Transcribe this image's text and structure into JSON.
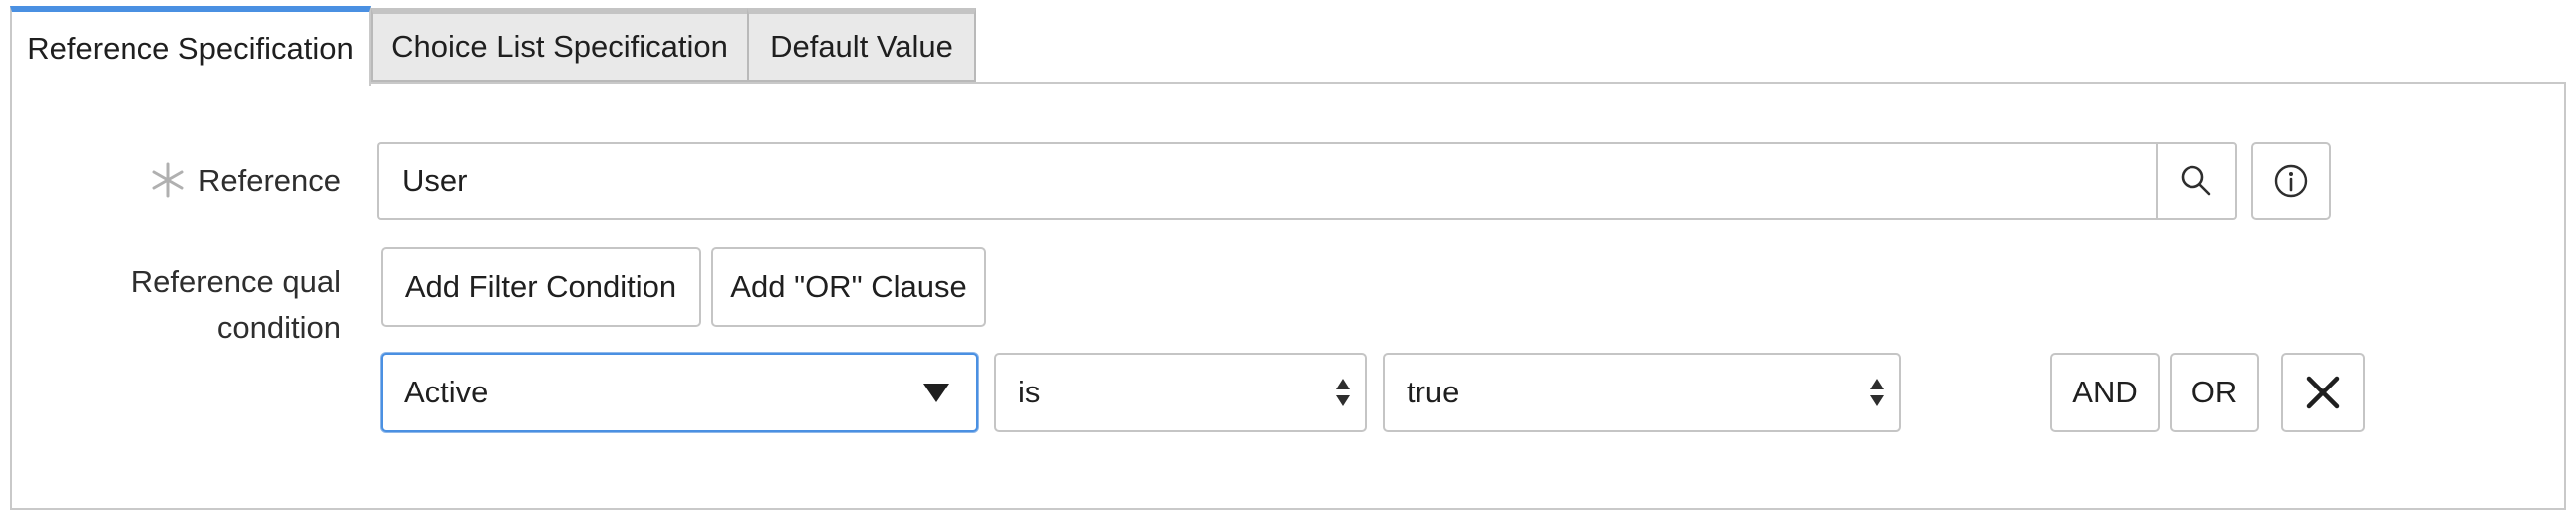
{
  "tabs": [
    {
      "label": "Reference Specification",
      "active": true
    },
    {
      "label": "Choice List Specification",
      "active": false
    },
    {
      "label": "Default Value",
      "active": false
    }
  ],
  "reference": {
    "label": "Reference",
    "required": true,
    "value": "User",
    "search_icon": "search-icon",
    "info_icon": "info-icon"
  },
  "qual_condition": {
    "label_line1": "Reference qual",
    "label_line2": "condition",
    "add_filter_label": "Add Filter Condition",
    "add_or_label": "Add \"OR\" Clause",
    "field_value": "Active",
    "operator_value": "is",
    "value_value": "true",
    "and_label": "AND",
    "or_label": "OR",
    "remove_icon": "close-icon"
  },
  "colors": {
    "accent": "#4a90e2",
    "required_star": "#b0b0b0",
    "border": "#c5c5c5",
    "inactive_tab_bg": "#e9e9e9"
  }
}
